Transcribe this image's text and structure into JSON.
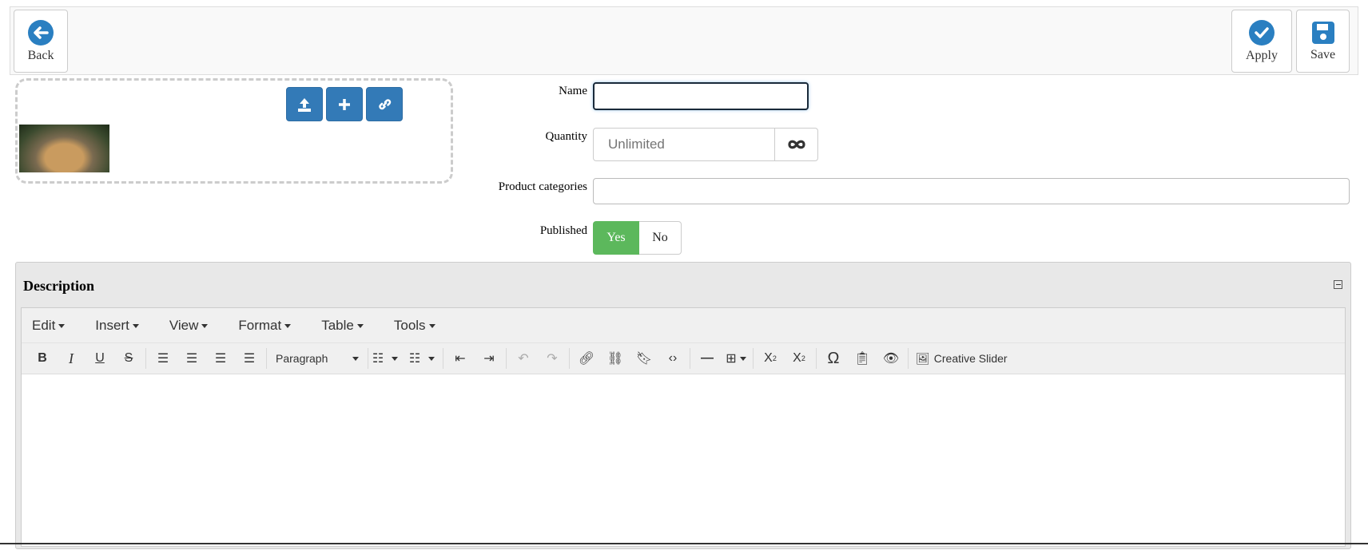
{
  "toolbar": {
    "back": "Back",
    "apply": "Apply",
    "save": "Save"
  },
  "form": {
    "name_label": "Name",
    "name_value": "",
    "quantity_label": "Quantity",
    "quantity_placeholder": "Unlimited",
    "categories_label": "Product categories",
    "published_label": "Published",
    "published_yes": "Yes",
    "published_no": "No"
  },
  "description": {
    "title": "Description",
    "menus": [
      "Edit",
      "Insert",
      "View",
      "Format",
      "Table",
      "Tools"
    ],
    "block_format": "Paragraph",
    "creative_slider": "Creative Slider"
  },
  "colors": {
    "primary": "#337ab7",
    "success": "#5cb85c",
    "icon_blue": "#2a7fc1"
  }
}
